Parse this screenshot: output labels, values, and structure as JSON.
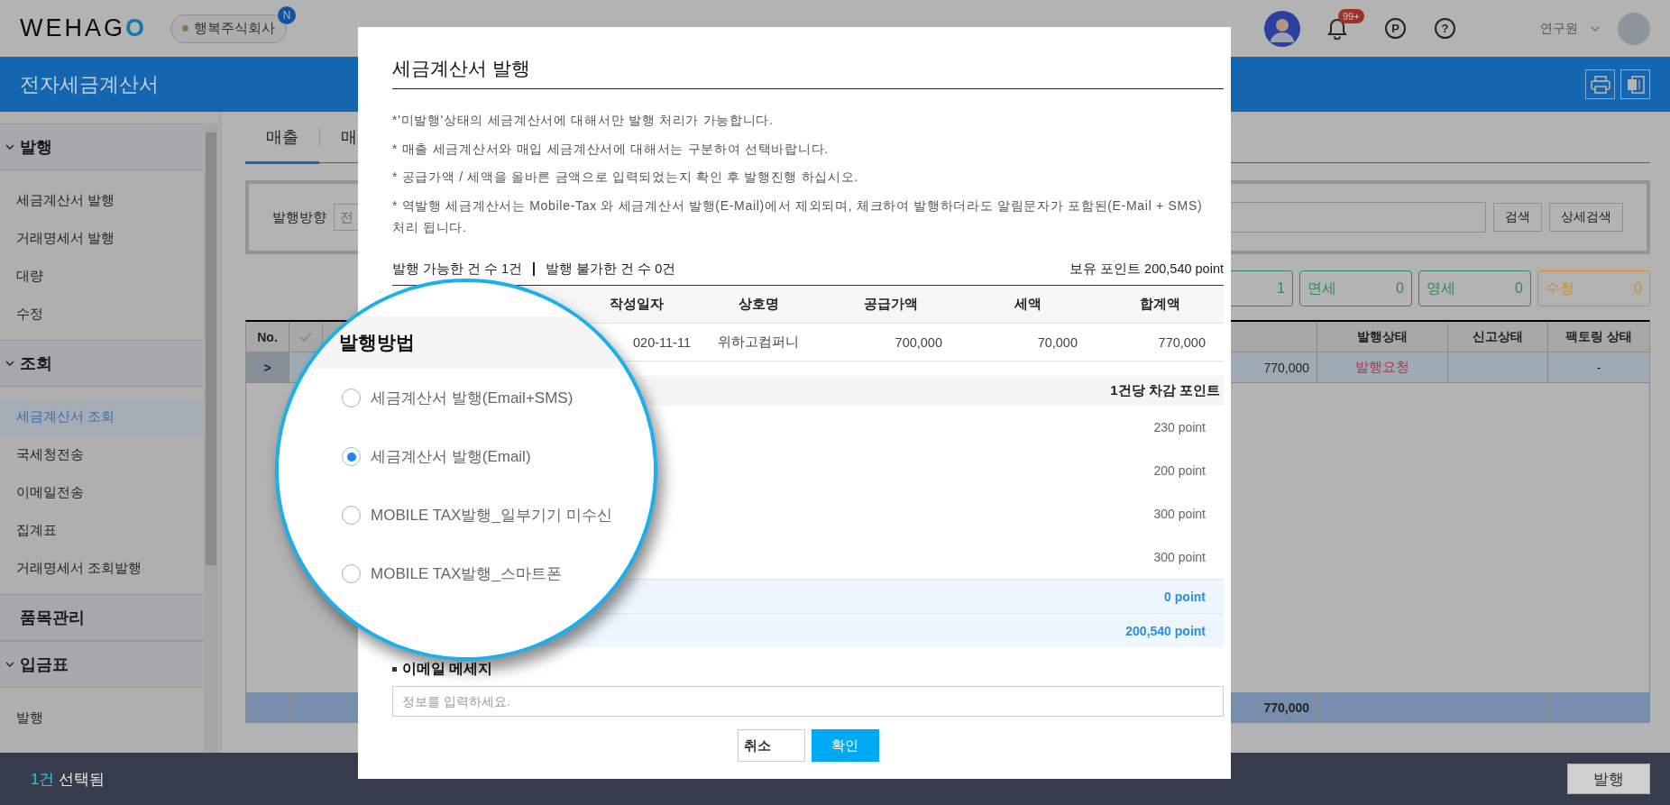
{
  "header": {
    "logo": "WEHAGO",
    "company": "행복주식회사",
    "company_badge": "N",
    "notification_count": "99+",
    "point_icon": "P",
    "help_icon": "?",
    "user": "연구원"
  },
  "title_bar": {
    "title": "전자세금계산서"
  },
  "sidebar": {
    "sections": [
      {
        "label": "발행",
        "expanded": true,
        "items": [
          {
            "label": "세금계산서 발행",
            "selected": false
          },
          {
            "label": "거래명세서 발행",
            "selected": false
          },
          {
            "label": "대량",
            "selected": false
          },
          {
            "label": "수정",
            "selected": false
          }
        ]
      },
      {
        "label": "조회",
        "expanded": true,
        "items": [
          {
            "label": "세금계산서 조회",
            "selected": true
          },
          {
            "label": "국세청전송",
            "selected": false
          },
          {
            "label": "이메일전송",
            "selected": false
          },
          {
            "label": "집계표",
            "selected": false
          },
          {
            "label": "거래명세서 조회발행",
            "selected": false
          }
        ]
      },
      {
        "label": "품목관리",
        "expanded": false
      },
      {
        "label": "입금표",
        "expanded": true,
        "items": [
          {
            "label": "발행",
            "selected": false
          }
        ]
      }
    ]
  },
  "tabs": [
    {
      "label": "매출",
      "selected": true
    },
    {
      "label": "매",
      "selected": false
    }
  ],
  "search": {
    "label": "발행방향",
    "select_value": "전",
    "buttons": [
      "검색",
      "상세검색"
    ]
  },
  "status_boxes": [
    {
      "count": "1",
      "color": "#2d8a55"
    },
    {
      "label": "면세",
      "count": "0",
      "color": "#2d8a55"
    },
    {
      "label": "영세",
      "count": "0",
      "color": "#2d8a55"
    },
    {
      "label": "수정",
      "count": "0",
      "color": "#d08a2a"
    }
  ],
  "table": {
    "columns": [
      "No.",
      "발행상태",
      "신고상태",
      "팩토링 상태"
    ],
    "rows": [
      {
        "expand": ">",
        "total": "770,000",
        "issue_status": "발행요청",
        "factoring_status": "-"
      }
    ],
    "footer_total": "770,000"
  },
  "modal": {
    "title": "세금계산서 발행",
    "notes": [
      "*'미발행'상태의 세금계산서에 대해서만 발행 처리가 가능합니다.",
      "* 매출 세금계산서와 매입 세금계산서에 대해서는 구분하여 선택바랍니다.",
      "* 공급가액 / 세액을 올바른 금액으로 입력되었는지 확인 후 발행진행 하십시오.",
      "* 역발행 세금계산서는 Mobile-Tax 와 세금계산서 발행(E-Mail)에서 제외되며, 체크하여 발행하더라도 알림문자가 포함된(E-Mail + SMS) 처리 됩니다."
    ],
    "available": "발행 가능한 건 수 1건",
    "unavailable": "발행 불가한 건 수 0건",
    "points_held": "보유 포인트 200,540 point",
    "table": {
      "columns": [
        "작성일자",
        "상호명",
        "공급가액",
        "세액",
        "합계액"
      ],
      "rows": [
        {
          "cells": [
            "020-11-11",
            "위하고컴퍼니",
            "700,000",
            "70,000",
            "770,000"
          ]
        }
      ]
    },
    "method": {
      "title": "발행방법",
      "points_header": "1건당 차감 포인트",
      "options": [
        {
          "label": "세금계산서 발행(Email+SMS)",
          "selected": false,
          "points": "230 point"
        },
        {
          "label": "세금계산서 발행(Email)",
          "selected": true,
          "points": "200 point"
        },
        {
          "label": "MOBILE TAX발행_일부기기 미수신",
          "selected": false,
          "points": "300 point"
        },
        {
          "label": "MOBILE TAX발행_스마트폰",
          "selected": false,
          "points": "300 point"
        }
      ]
    },
    "deducted": "0 point",
    "remaining": "200,540 point",
    "email": {
      "label": "이메일 메세지",
      "placeholder": "정보를 입력하세요."
    },
    "buttons": [
      {
        "label": "취소",
        "kind": "secondary"
      },
      {
        "label": "확인",
        "kind": "primary"
      }
    ]
  },
  "bottom_bar": {
    "count": "1건",
    "label": "선택됨",
    "action": "발행"
  }
}
